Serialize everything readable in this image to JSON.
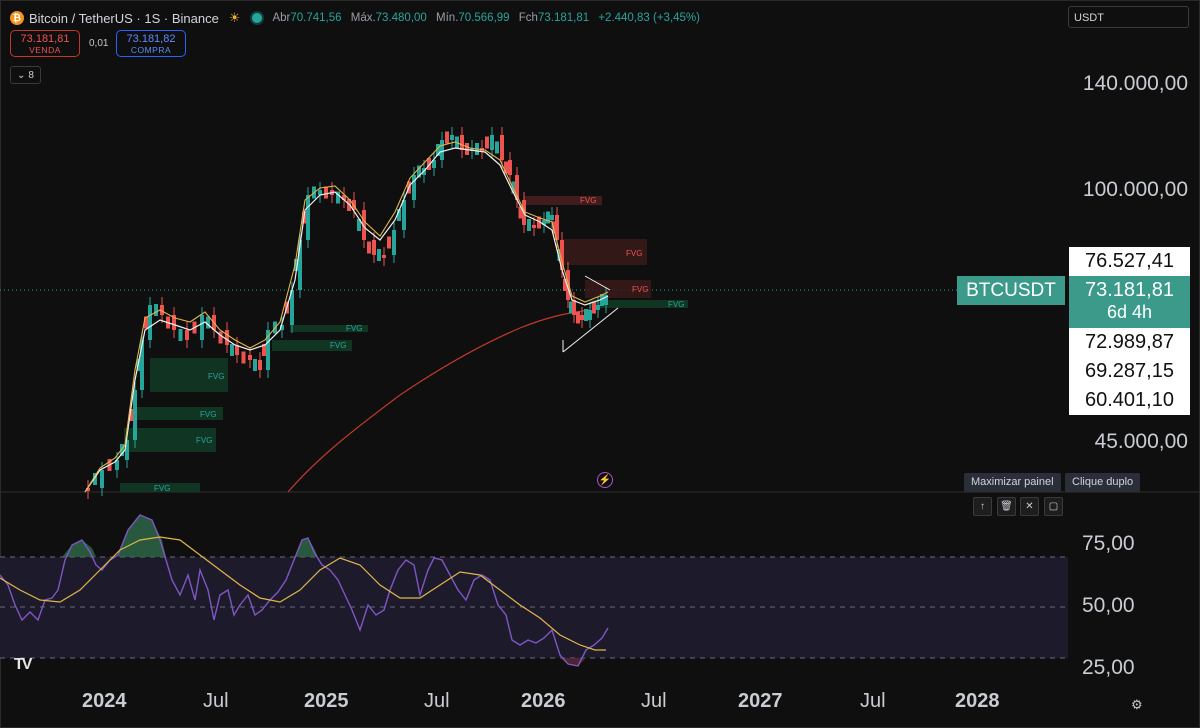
{
  "header": {
    "symbol": "Bitcoin / TetherUS · 1S · Binance",
    "ohlc": [
      {
        "k": "Abr",
        "v": "70.741,56"
      },
      {
        "k": "Máx.",
        "v": "73.480,00"
      },
      {
        "k": "Mín.",
        "v": "70.566,99"
      },
      {
        "k": "Fch",
        "v": "73.181,81"
      }
    ],
    "change": "+2.440,83 (+3,45%)"
  },
  "trade": {
    "sell_price": "73.181,81",
    "sell_label": "VENDA",
    "spread": "0,01",
    "buy_price": "73.181,82",
    "buy_label": "COMPRA"
  },
  "indicators_count": "8",
  "currency": "USDT",
  "price_axis": [
    "140.000,00",
    "100.000,00",
    "45.000,00"
  ],
  "price_labels": [
    "76.527,41",
    "72.989,87",
    "69.287,15",
    "60.401,10"
  ],
  "current": {
    "symbol": "BTCUSDT",
    "price": "73.181,81",
    "countdown": "6d 4h"
  },
  "tooltip": {
    "maximize": "Maximizar painel",
    "double_click": "Clique duplo"
  },
  "rsi_axis": [
    "75,00",
    "50,00",
    "25,00"
  ],
  "x_axis": [
    {
      "label": "2024",
      "bold": true
    },
    {
      "label": "Jul",
      "bold": false
    },
    {
      "label": "2025",
      "bold": true
    },
    {
      "label": "Jul",
      "bold": false
    },
    {
      "label": "2026",
      "bold": true
    },
    {
      "label": "Jul",
      "bold": false
    },
    {
      "label": "2027",
      "bold": true
    },
    {
      "label": "Jul",
      "bold": false
    },
    {
      "label": "2028",
      "bold": true
    }
  ],
  "fvg_label": "FVG",
  "colors": {
    "up": "#26a69a",
    "down": "#ef5350",
    "accent": "#3b9a8a",
    "rsi": "#7e57c2",
    "ma": "#e0b64a"
  },
  "icons": [
    "bitcoin-icon",
    "sun-icon",
    "status-dot-icon",
    "chevron-down-icon",
    "lightning-icon",
    "arrow-up-icon",
    "trash-icon",
    "collapse-icon",
    "maximize-icon",
    "gear-icon",
    "tradingview-logo"
  ]
}
